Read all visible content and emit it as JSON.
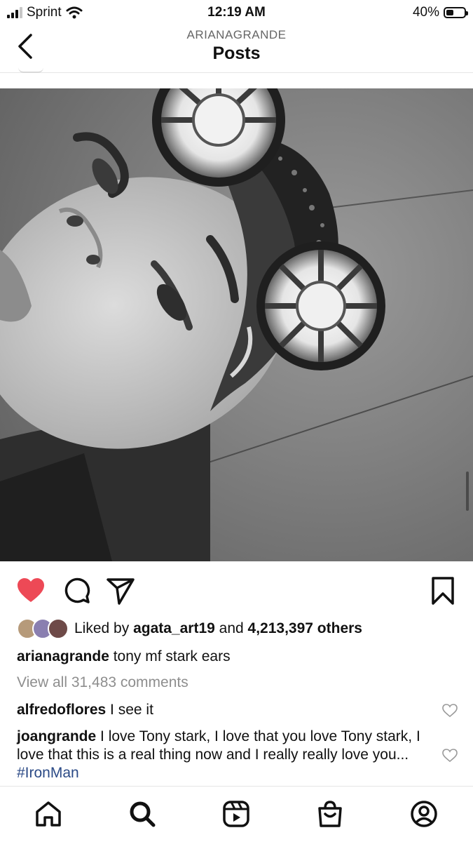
{
  "status_bar": {
    "carrier": "Sprint",
    "time": "12:19 AM",
    "battery_percent_label": "40%",
    "battery_level": 0.4,
    "icons": [
      "signal-icon",
      "wifi-icon",
      "battery-icon"
    ]
  },
  "header": {
    "subtitle": "ARIANAGRANDE",
    "title": "Posts",
    "back_icon": "chevron-left-icon"
  },
  "post": {
    "image_description_icon": "photo",
    "actions": {
      "like_icon": "heart-filled-icon",
      "like_color": "#ed4956",
      "comment_icon": "comment-icon",
      "share_icon": "send-icon",
      "save_icon": "bookmark-icon"
    },
    "likes": {
      "prefix": "Liked by ",
      "user": "agata_art19",
      "middle": " and ",
      "count": "4,213,397 others"
    },
    "caption": {
      "user": "arianagrande",
      "text": " tony mf stark ears"
    },
    "view_all_comments": "View all 31,483 comments",
    "comments": [
      {
        "user": "alfredoflores",
        "text": " I see it"
      },
      {
        "user": "joangrande",
        "text": " I love Tony stark, I love that you love Tony stark, I love that this is a real thing now and I really really love you... ",
        "hashtag": "#IronMan"
      }
    ]
  },
  "tab_bar": {
    "items": [
      "home-icon",
      "search-icon",
      "reels-icon",
      "shop-icon",
      "profile-icon"
    ]
  }
}
